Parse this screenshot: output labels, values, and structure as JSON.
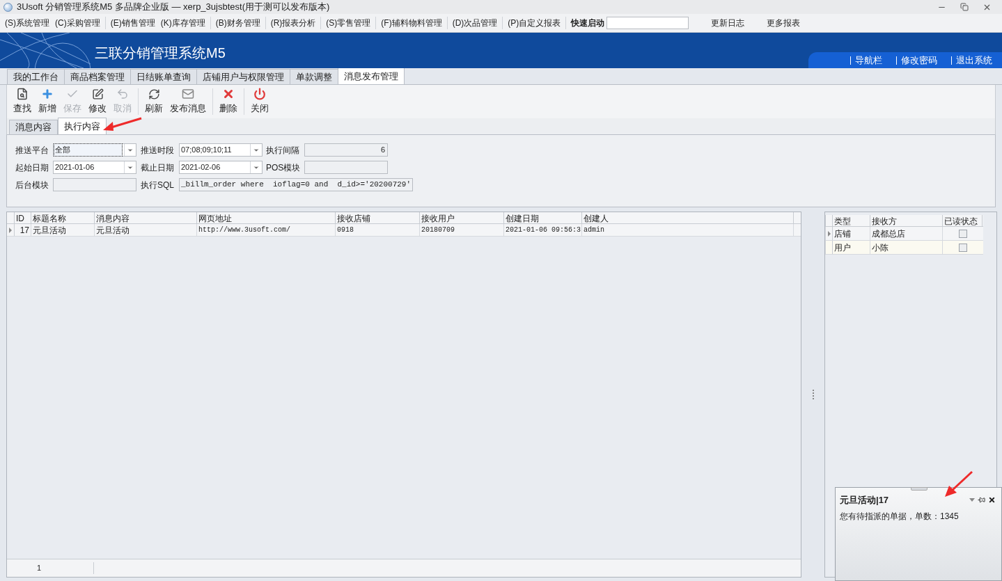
{
  "window": {
    "title": "3Usoft 分销管理系统M5 多品牌企业版 — xerp_3ujsbtest(用于测可以发布版本)"
  },
  "menu": [
    "(S)系统管理",
    "(C)采购管理",
    "(E)销售管理",
    "(K)库存管理",
    "(B)财务管理",
    "(R)报表分析",
    "(S)零售管理",
    "(F)辅料物料管理",
    "(D)次品管理",
    "(P)自定义报表"
  ],
  "quick_launch": {
    "label": "快速启动"
  },
  "menu_links": [
    "更新日志",
    "更多报表"
  ],
  "banner": {
    "title": "三联分销管理系统M5",
    "links": [
      "导航栏",
      "修改密码",
      "退出系统"
    ]
  },
  "tabs": [
    {
      "label": "我的工作台",
      "selected": false
    },
    {
      "label": "商品档案管理",
      "selected": false
    },
    {
      "label": "日结账单查询",
      "selected": false
    },
    {
      "label": "店铺用户与权限管理",
      "selected": false
    },
    {
      "label": "单款调整",
      "selected": false
    },
    {
      "label": "消息发布管理",
      "selected": true
    }
  ],
  "toolbar": [
    {
      "label": "查找",
      "kind": "find",
      "disabled": false
    },
    {
      "label": "新增",
      "kind": "add",
      "disabled": false
    },
    {
      "label": "保存",
      "kind": "save",
      "disabled": true
    },
    {
      "label": "修改",
      "kind": "edit",
      "disabled": false
    },
    {
      "label": "取消",
      "kind": "cancel",
      "disabled": true
    },
    {
      "label": "刷新",
      "kind": "refresh",
      "disabled": false
    },
    {
      "label": "发布消息",
      "kind": "mail",
      "disabled": false
    },
    {
      "label": "删除",
      "kind": "delete",
      "disabled": false
    },
    {
      "label": "关闭",
      "kind": "close",
      "disabled": false
    }
  ],
  "subtabs": [
    {
      "label": "消息内容",
      "selected": false
    },
    {
      "label": "执行内容",
      "selected": true
    }
  ],
  "form": [
    {
      "label": "推送平台",
      "value": "全部",
      "kind": "select",
      "focused": true
    },
    {
      "label": "推送时段",
      "value": "07;08;09;10;11",
      "kind": "select"
    },
    {
      "label": "执行间隔",
      "value": "6",
      "kind": "number"
    },
    {
      "label": "起始日期",
      "value": "2021-01-06",
      "kind": "select"
    },
    {
      "label": "截止日期",
      "value": "2021-02-06",
      "kind": "select"
    },
    {
      "label": "POS模块",
      "kind": "text"
    },
    {
      "label": "后台模块",
      "kind": "text"
    },
    {
      "label": "执行SQL",
      "value": "_billm_order where  ioflag=0 and  d_id>='20200729'",
      "kind": "code"
    }
  ],
  "table": {
    "columns": [
      "ID",
      "标题名称",
      "消息内容",
      "网页地址",
      "接收店铺",
      "接收用户",
      "创建日期",
      "创建人"
    ],
    "rows": [
      {
        "current": true,
        "cells": [
          "17",
          "元旦活动",
          "元旦活动",
          "http://www.3usoft.com/",
          "0918",
          "20180709",
          "2021-01-06 09:56:3",
          "admin"
        ]
      }
    ],
    "footer": "1"
  },
  "detail_table": {
    "columns": [
      "类型",
      "接收方",
      "已读状态"
    ],
    "rows": [
      {
        "current": true,
        "type": "店铺",
        "receiver": "成都总店",
        "read": false
      },
      {
        "current": false,
        "type": "用户",
        "receiver": "小陈",
        "read": false
      }
    ]
  },
  "popup": {
    "title": "元旦活动|17",
    "message": "您有待指派的单据，单数：1345"
  }
}
